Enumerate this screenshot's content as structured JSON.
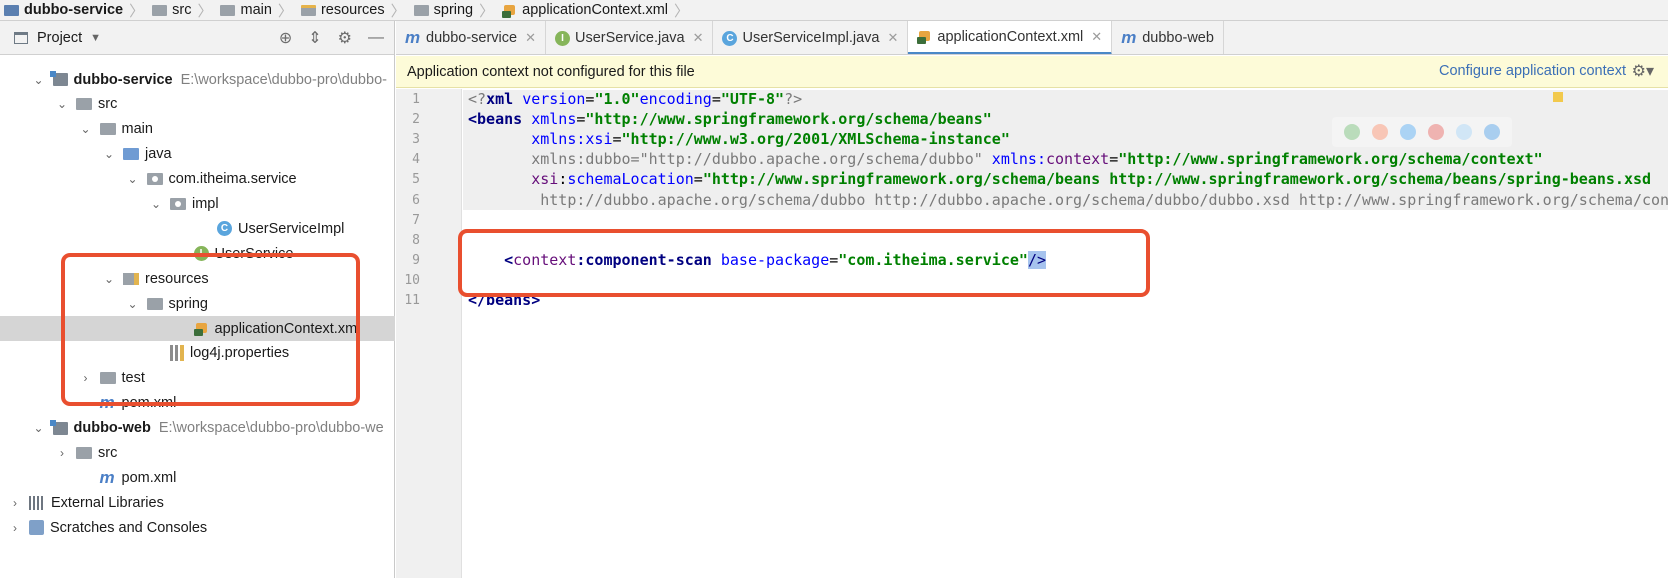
{
  "breadcrumb": [
    "dubbo-service",
    "src",
    "main",
    "resources",
    "spring",
    "applicationContext.xml"
  ],
  "sidebar": {
    "title": "Project",
    "rows": [
      {
        "label": "dubbo-service",
        "path": "E:\\workspace\\dubbo-pro\\dubbo-",
        "icon": "module-icon",
        "arrow": "down",
        "depth": 0,
        "bold": true
      },
      {
        "label": "src",
        "icon": "folder-icon",
        "arrow": "down",
        "depth": 1
      },
      {
        "label": "main",
        "icon": "folder-icon",
        "arrow": "down",
        "depth": 2
      },
      {
        "label": "java",
        "icon": "source-folder-icon",
        "arrow": "down",
        "depth": 3
      },
      {
        "label": "com.itheima.service",
        "icon": "package-icon",
        "arrow": "down",
        "depth": 4
      },
      {
        "label": "impl",
        "icon": "package-icon",
        "arrow": "down",
        "depth": 5
      },
      {
        "label": "UserServiceImpl",
        "icon": "class-icon",
        "arrow": "",
        "depth": 7
      },
      {
        "label": "UserService",
        "icon": "interface-icon",
        "arrow": "",
        "depth": 6
      },
      {
        "label": "resources",
        "icon": "resources-folder-icon",
        "arrow": "down",
        "depth": 3
      },
      {
        "label": "spring",
        "icon": "folder-icon",
        "arrow": "down",
        "depth": 4
      },
      {
        "label": "applicationContext.xml",
        "icon": "xml-file-icon",
        "arrow": "",
        "depth": 6,
        "selected": true
      },
      {
        "label": "log4j.properties",
        "icon": "properties-file-icon",
        "arrow": "",
        "depth": 5
      },
      {
        "label": "test",
        "icon": "folder-icon",
        "arrow": "right",
        "depth": 2
      },
      {
        "label": "pom.xml",
        "icon": "maven-icon",
        "arrow": "",
        "depth": 2
      },
      {
        "label": "dubbo-web",
        "path": "E:\\workspace\\dubbo-pro\\dubbo-we",
        "icon": "module-icon",
        "arrow": "down",
        "depth": 0,
        "bold": true
      },
      {
        "label": "src",
        "icon": "folder-icon",
        "arrow": "right",
        "depth": 1
      },
      {
        "label": "pom.xml",
        "icon": "maven-icon",
        "arrow": "",
        "depth": 2
      },
      {
        "label": "External Libraries",
        "icon": "library-icon",
        "arrow": "right",
        "depth": -1
      },
      {
        "label": "Scratches and Consoles",
        "icon": "scratches-icon",
        "arrow": "right",
        "depth": -1
      }
    ]
  },
  "tabs": [
    {
      "label": "dubbo-service",
      "icon": "maven-icon"
    },
    {
      "label": "UserService.java",
      "icon": "interface-icon"
    },
    {
      "label": "UserServiceImpl.java",
      "icon": "class-icon"
    },
    {
      "label": "applicationContext.xml",
      "icon": "xml-file-icon",
      "active": true
    },
    {
      "label": "dubbo-web",
      "icon": "maven-icon",
      "noclose": true
    }
  ],
  "notice": {
    "text": "Application context not configured for this file",
    "link": "Configure application context"
  },
  "editor": {
    "line_numbers": [
      "1",
      "2",
      "3",
      "4",
      "5",
      "6",
      "7",
      "8",
      "9",
      "10",
      "11"
    ],
    "lines": {
      "l1": [
        "<?",
        "xml ",
        "version",
        "=",
        "\"1.0\"",
        "encoding",
        "=",
        "\"UTF-8\"",
        "?>"
      ],
      "l2": [
        "<beans ",
        "xmlns",
        "=",
        "\"http://www.springframework.org/schema/beans\""
      ],
      "l3": [
        "       ",
        "xmlns:",
        "xsi",
        "=",
        "\"http://www.w3.org/2001/XMLSchema-instance\""
      ],
      "l4": [
        "       xmlns:dubbo=\"http://dubbo.apache.org/schema/dubbo\" ",
        "xmlns:",
        "context",
        "=",
        "\"http://www.springframework.org/schema/context\""
      ],
      "l5": [
        "       ",
        "xsi",
        "",
        "schemaLocation",
        "=",
        "\"http://www.springframework.org/schema/beans http://www.springframework.org/schema/beans/spring-beans.xsd"
      ],
      "l6": "        http://dubbo.apache.org/schema/dubbo http://dubbo.apache.org/schema/dubbo/dubbo.xsd http://www.springframework.org/schema/context",
      "l9": [
        "    ",
        "<",
        "context",
        "component-scan ",
        "base-package",
        "=",
        "\"com.itheima.service\"",
        "/>"
      ],
      "l11": [
        "</beans>"
      ]
    }
  }
}
